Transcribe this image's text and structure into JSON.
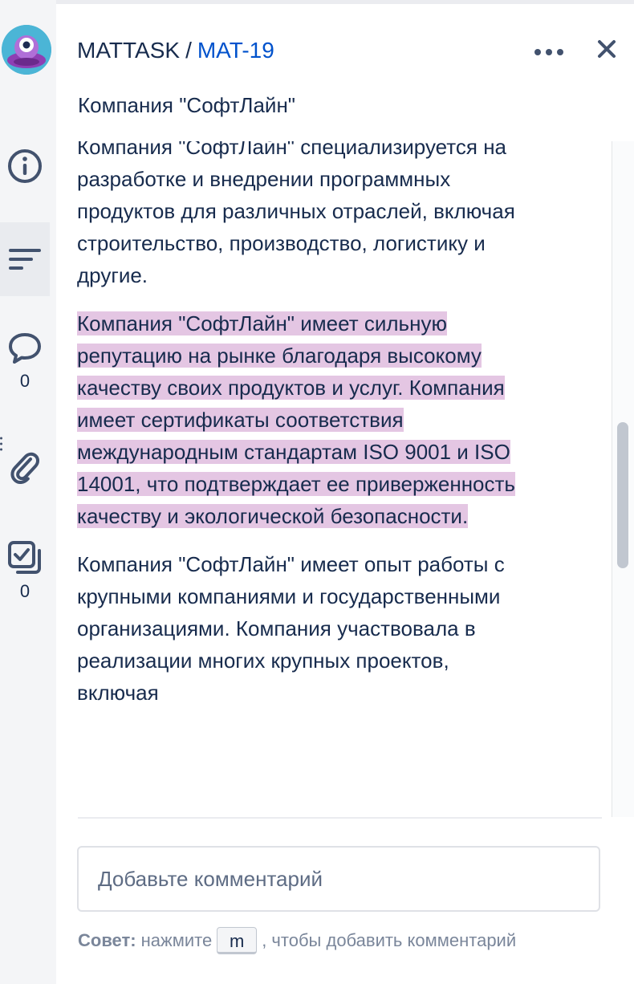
{
  "header": {
    "project": "MATTASK",
    "separator": "/",
    "issue_key": "MAT-19"
  },
  "sticky_title": "Компания \"СофтЛайн\"",
  "sidebar": {
    "comments_count": "0",
    "checklist_count": "0"
  },
  "content": {
    "paragraphs": [
      "Компания \"СофтЛайн\" специализируется на разработке и внедрении программных продуктов для различных отраслей, включая строительство, производство, логистику и другие.",
      "Компания \"СофтЛайн\" имеет сильную репутацию на рынке благодаря высокому качеству своих продуктов и услуг. Компания имеет сертификаты соответствия международным стандартам ISO 9001 и ISO 14001, что подтверждает ее приверженность качеству и экологической безопасности.",
      "Компания \"СофтЛайн\" имеет опыт работы с крупными компаниями и государственными организациями. Компания участвовала в реализации многих крупных проектов, включая"
    ]
  },
  "comment": {
    "placeholder": "Добавьте комментарий"
  },
  "tip": {
    "label": "Совет:",
    "before": "нажмите",
    "key": "m",
    "after": ", чтобы добавить комментарий"
  },
  "colors": {
    "link": "#0052cc",
    "text": "#172b4d",
    "highlight": "#e4c6e3",
    "rail": "#f4f5f7"
  }
}
